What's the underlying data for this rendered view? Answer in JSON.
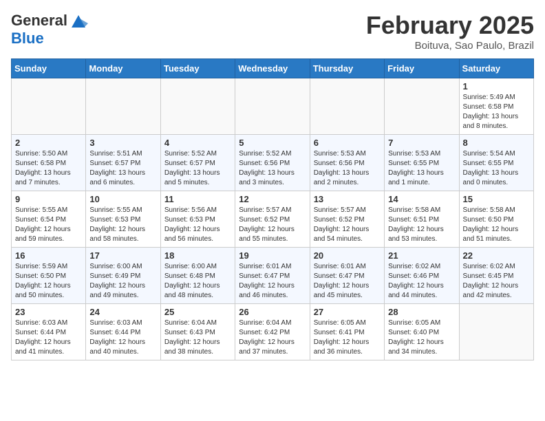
{
  "header": {
    "logo_line1": "General",
    "logo_line2": "Blue",
    "month_title": "February 2025",
    "location": "Boituva, Sao Paulo, Brazil"
  },
  "weekdays": [
    "Sunday",
    "Monday",
    "Tuesday",
    "Wednesday",
    "Thursday",
    "Friday",
    "Saturday"
  ],
  "weeks": [
    [
      {
        "day": "",
        "info": ""
      },
      {
        "day": "",
        "info": ""
      },
      {
        "day": "",
        "info": ""
      },
      {
        "day": "",
        "info": ""
      },
      {
        "day": "",
        "info": ""
      },
      {
        "day": "",
        "info": ""
      },
      {
        "day": "1",
        "info": "Sunrise: 5:49 AM\nSunset: 6:58 PM\nDaylight: 13 hours and 8 minutes."
      }
    ],
    [
      {
        "day": "2",
        "info": "Sunrise: 5:50 AM\nSunset: 6:58 PM\nDaylight: 13 hours and 7 minutes."
      },
      {
        "day": "3",
        "info": "Sunrise: 5:51 AM\nSunset: 6:57 PM\nDaylight: 13 hours and 6 minutes."
      },
      {
        "day": "4",
        "info": "Sunrise: 5:52 AM\nSunset: 6:57 PM\nDaylight: 13 hours and 5 minutes."
      },
      {
        "day": "5",
        "info": "Sunrise: 5:52 AM\nSunset: 6:56 PM\nDaylight: 13 hours and 3 minutes."
      },
      {
        "day": "6",
        "info": "Sunrise: 5:53 AM\nSunset: 6:56 PM\nDaylight: 13 hours and 2 minutes."
      },
      {
        "day": "7",
        "info": "Sunrise: 5:53 AM\nSunset: 6:55 PM\nDaylight: 13 hours and 1 minute."
      },
      {
        "day": "8",
        "info": "Sunrise: 5:54 AM\nSunset: 6:55 PM\nDaylight: 13 hours and 0 minutes."
      }
    ],
    [
      {
        "day": "9",
        "info": "Sunrise: 5:55 AM\nSunset: 6:54 PM\nDaylight: 12 hours and 59 minutes."
      },
      {
        "day": "10",
        "info": "Sunrise: 5:55 AM\nSunset: 6:53 PM\nDaylight: 12 hours and 58 minutes."
      },
      {
        "day": "11",
        "info": "Sunrise: 5:56 AM\nSunset: 6:53 PM\nDaylight: 12 hours and 56 minutes."
      },
      {
        "day": "12",
        "info": "Sunrise: 5:57 AM\nSunset: 6:52 PM\nDaylight: 12 hours and 55 minutes."
      },
      {
        "day": "13",
        "info": "Sunrise: 5:57 AM\nSunset: 6:52 PM\nDaylight: 12 hours and 54 minutes."
      },
      {
        "day": "14",
        "info": "Sunrise: 5:58 AM\nSunset: 6:51 PM\nDaylight: 12 hours and 53 minutes."
      },
      {
        "day": "15",
        "info": "Sunrise: 5:58 AM\nSunset: 6:50 PM\nDaylight: 12 hours and 51 minutes."
      }
    ],
    [
      {
        "day": "16",
        "info": "Sunrise: 5:59 AM\nSunset: 6:50 PM\nDaylight: 12 hours and 50 minutes."
      },
      {
        "day": "17",
        "info": "Sunrise: 6:00 AM\nSunset: 6:49 PM\nDaylight: 12 hours and 49 minutes."
      },
      {
        "day": "18",
        "info": "Sunrise: 6:00 AM\nSunset: 6:48 PM\nDaylight: 12 hours and 48 minutes."
      },
      {
        "day": "19",
        "info": "Sunrise: 6:01 AM\nSunset: 6:47 PM\nDaylight: 12 hours and 46 minutes."
      },
      {
        "day": "20",
        "info": "Sunrise: 6:01 AM\nSunset: 6:47 PM\nDaylight: 12 hours and 45 minutes."
      },
      {
        "day": "21",
        "info": "Sunrise: 6:02 AM\nSunset: 6:46 PM\nDaylight: 12 hours and 44 minutes."
      },
      {
        "day": "22",
        "info": "Sunrise: 6:02 AM\nSunset: 6:45 PM\nDaylight: 12 hours and 42 minutes."
      }
    ],
    [
      {
        "day": "23",
        "info": "Sunrise: 6:03 AM\nSunset: 6:44 PM\nDaylight: 12 hours and 41 minutes."
      },
      {
        "day": "24",
        "info": "Sunrise: 6:03 AM\nSunset: 6:44 PM\nDaylight: 12 hours and 40 minutes."
      },
      {
        "day": "25",
        "info": "Sunrise: 6:04 AM\nSunset: 6:43 PM\nDaylight: 12 hours and 38 minutes."
      },
      {
        "day": "26",
        "info": "Sunrise: 6:04 AM\nSunset: 6:42 PM\nDaylight: 12 hours and 37 minutes."
      },
      {
        "day": "27",
        "info": "Sunrise: 6:05 AM\nSunset: 6:41 PM\nDaylight: 12 hours and 36 minutes."
      },
      {
        "day": "28",
        "info": "Sunrise: 6:05 AM\nSunset: 6:40 PM\nDaylight: 12 hours and 34 minutes."
      },
      {
        "day": "",
        "info": ""
      }
    ]
  ]
}
